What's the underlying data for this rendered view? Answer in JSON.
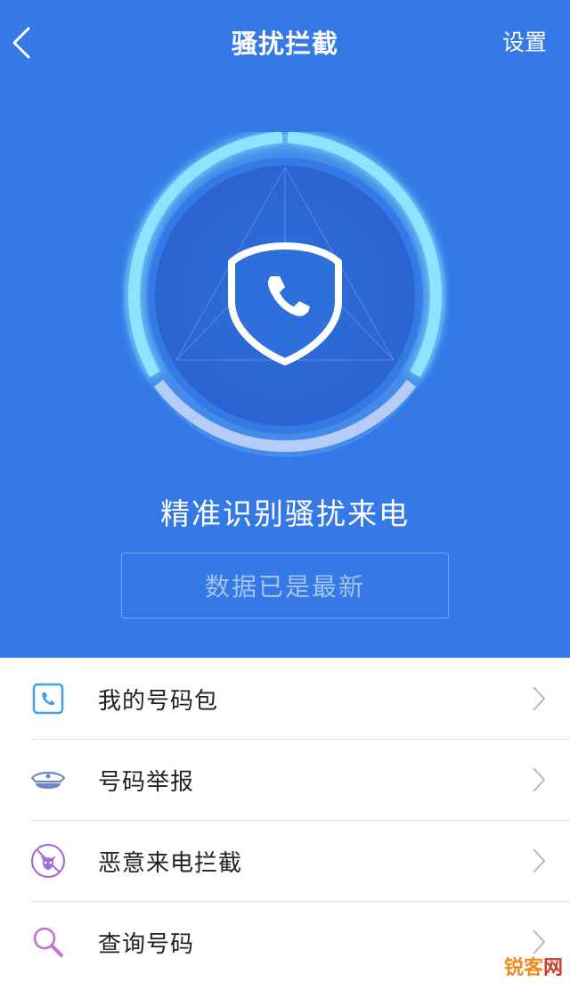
{
  "header": {
    "title": "骚扰拦截",
    "settings_label": "设置"
  },
  "hero": {
    "slogan": "精准识别骚扰来电",
    "status_text": "数据已是最新"
  },
  "menu": {
    "items": [
      {
        "label": "我的号码包",
        "icon": "phone-book-icon"
      },
      {
        "label": "号码举报",
        "icon": "police-cap-icon"
      },
      {
        "label": "恶意来电拦截",
        "icon": "devil-block-icon"
      },
      {
        "label": "查询号码",
        "icon": "search-icon"
      }
    ]
  },
  "watermark": {
    "part1": "锐客",
    "part2": "网"
  },
  "colors": {
    "primary": "#3479e6",
    "ring": "#8ee4ff",
    "text": "#222222",
    "divider": "#e3e3e3"
  }
}
